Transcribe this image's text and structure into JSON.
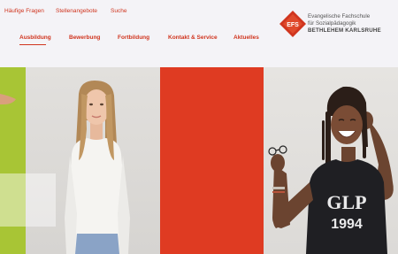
{
  "utility_nav": [
    {
      "label": "Häufige Fragen"
    },
    {
      "label": "Stellenangebote"
    },
    {
      "label": "Suche"
    }
  ],
  "main_nav": [
    {
      "label": "Ausbildung",
      "active": true
    },
    {
      "label": "Bewerbung"
    },
    {
      "label": "Fortbildung"
    },
    {
      "label": "Kontakt & Service"
    },
    {
      "label": "Aktuelles"
    }
  ],
  "logo": {
    "mark_text": "EFS",
    "line1": "Evangelische Fachschule",
    "line2": "für Sozialpädagogik",
    "line3": "BETHLEHEM KARLSRUHE"
  },
  "hero": {
    "shirt_text_top": "GLP",
    "shirt_text_bottom": "1994"
  },
  "colors": {
    "brand_red": "#d0351f",
    "panel_red": "#df3b22",
    "accent_green": "#a8c535"
  }
}
